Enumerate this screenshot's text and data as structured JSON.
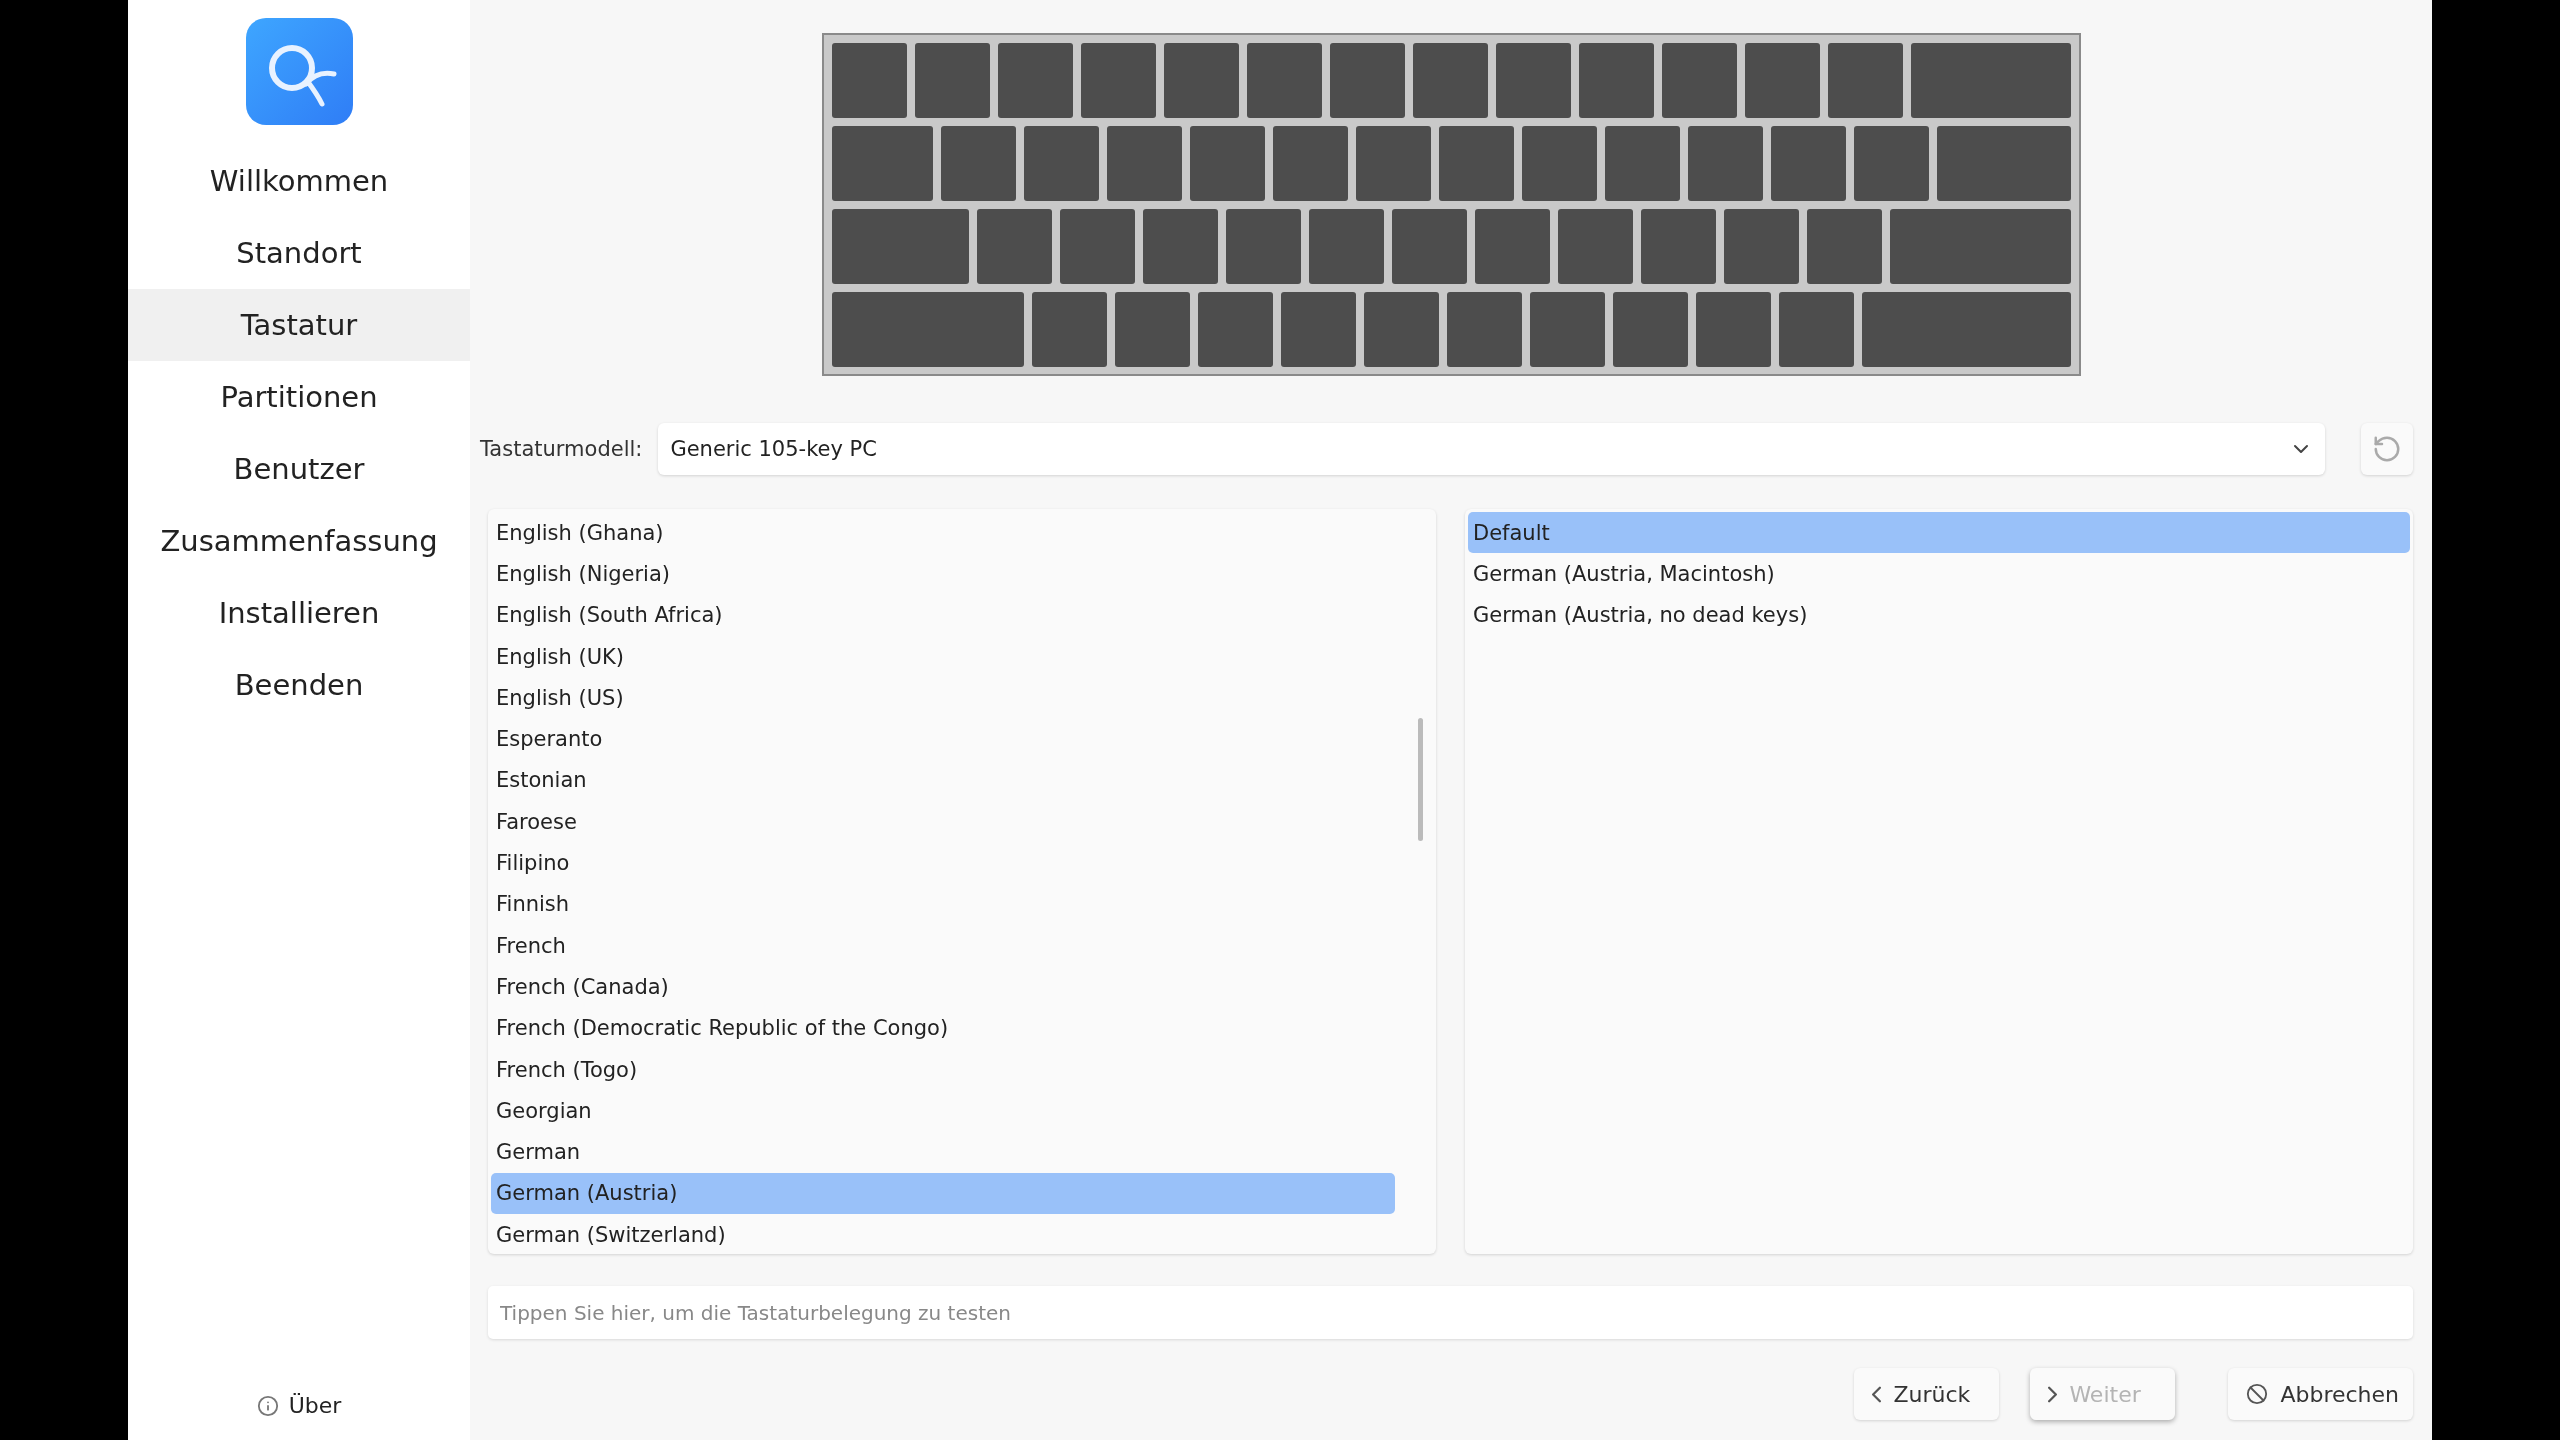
{
  "sidebar": {
    "items": [
      {
        "label": "Willkommen",
        "selected": false
      },
      {
        "label": "Standort",
        "selected": false
      },
      {
        "label": "Tastatur",
        "selected": true
      },
      {
        "label": "Partitionen",
        "selected": false
      },
      {
        "label": "Benutzer",
        "selected": false
      },
      {
        "label": "Zusammenfassung",
        "selected": false
      },
      {
        "label": "Installieren",
        "selected": false
      },
      {
        "label": "Beenden",
        "selected": false
      }
    ],
    "about": "Über"
  },
  "keyboard_model": {
    "label": "Tastaturmodell:",
    "value": "Generic 105-key PC"
  },
  "layouts": [
    {
      "label": "English (Ghana)",
      "selected": false
    },
    {
      "label": "English (Nigeria)",
      "selected": false
    },
    {
      "label": "English (South Africa)",
      "selected": false
    },
    {
      "label": "English (UK)",
      "selected": false
    },
    {
      "label": "English (US)",
      "selected": false
    },
    {
      "label": "Esperanto",
      "selected": false
    },
    {
      "label": "Estonian",
      "selected": false
    },
    {
      "label": "Faroese",
      "selected": false
    },
    {
      "label": "Filipino",
      "selected": false
    },
    {
      "label": "Finnish",
      "selected": false
    },
    {
      "label": "French",
      "selected": false
    },
    {
      "label": "French (Canada)",
      "selected": false
    },
    {
      "label": "French (Democratic Republic of the Congo)",
      "selected": false
    },
    {
      "label": "French (Togo)",
      "selected": false
    },
    {
      "label": "Georgian",
      "selected": false
    },
    {
      "label": "German",
      "selected": false
    },
    {
      "label": "German (Austria)",
      "selected": true
    },
    {
      "label": "German (Switzerland)",
      "selected": false
    }
  ],
  "variants": [
    {
      "label": "Default",
      "selected": true
    },
    {
      "label": "German (Austria, Macintosh)",
      "selected": false
    },
    {
      "label": "German (Austria, no dead keys)",
      "selected": false
    }
  ],
  "test_field": {
    "placeholder": "Tippen Sie hier, um die Tastaturbelegung zu testen"
  },
  "buttons": [
    {
      "kind": "back",
      "label": "Zurück",
      "disabled": false
    },
    {
      "kind": "next",
      "label": "Weiter",
      "disabled": true
    },
    {
      "kind": "cancel",
      "label": "Abbrechen",
      "disabled": false
    }
  ]
}
